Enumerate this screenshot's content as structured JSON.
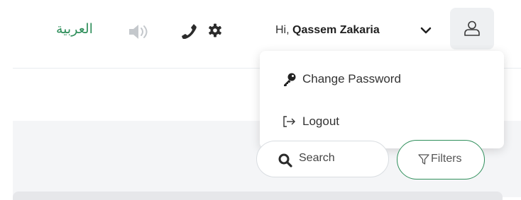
{
  "header": {
    "language_label": "العربية",
    "greeting": "Hi,",
    "user_name": "Qassem Zakaria",
    "icons": [
      "speaker-icon",
      "phone-icon",
      "gear-icon",
      "chevron-down-icon",
      "user-icon"
    ]
  },
  "user_menu": {
    "items": [
      {
        "label": "Change Password",
        "icon": "key-icon"
      },
      {
        "label": "Logout",
        "icon": "logout-icon"
      }
    ]
  },
  "toolbar": {
    "search_label": "Search",
    "filters_label": "Filters"
  },
  "colors": {
    "accent": "#2f8f5b",
    "icon_dark": "#2b2b2b",
    "icon_muted": "#c4c8cc"
  }
}
